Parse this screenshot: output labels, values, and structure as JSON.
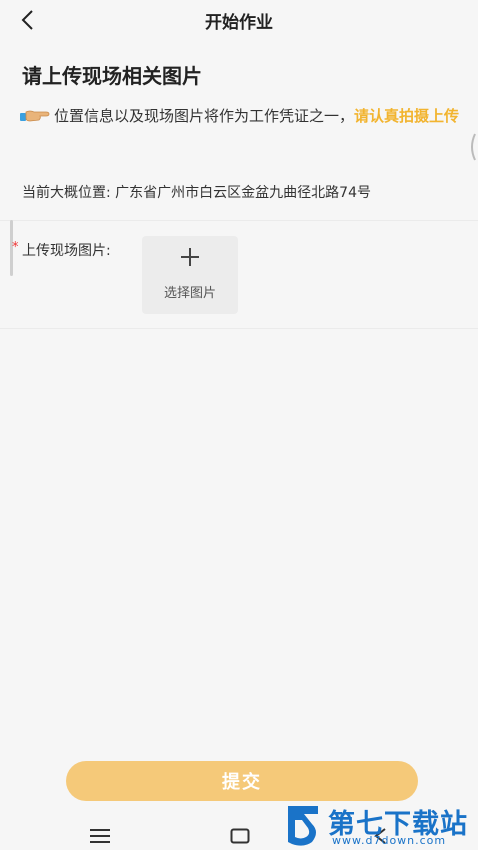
{
  "header": {
    "title": "开始作业",
    "back_icon": "chevron-left-icon"
  },
  "main": {
    "heading": "请上传现场相关图片",
    "notice_text": "位置信息以及现场图片将作为工作凭证之一，",
    "notice_highlight": "请认真拍摄上传",
    "notice_icon": "pointing-hand-icon",
    "location_text": "当前大概位置: 广东省广州市白云区金盆九曲径北路74号",
    "required_mark": "*",
    "upload_label": "上传现场图片:",
    "upload_button_label": "选择图片",
    "upload_icon": "plus-icon"
  },
  "footer": {
    "submit_label": "提交"
  },
  "navbar": {
    "menu_icon": "menu-icon",
    "home_icon": "square-icon",
    "back_icon": "back-triangle-icon"
  },
  "watermark": {
    "brand": "第七下载站",
    "url": "www.d7down.com"
  },
  "colors": {
    "accent": "#f2b42f",
    "submit_bg": "#f5c979",
    "required": "#ee3333",
    "watermark": "#1a73c8"
  }
}
